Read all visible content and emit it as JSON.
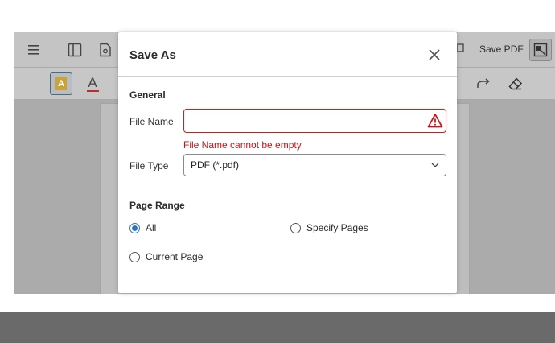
{
  "toolbar": {
    "save_pdf_label": "Save PDF"
  },
  "dialog": {
    "title": "Save As",
    "general": {
      "heading": "General",
      "file_name_label": "File Name",
      "file_name_value": "",
      "file_name_error": "File Name cannot be empty",
      "file_type_label": "File Type",
      "file_type_value": "PDF (*.pdf)"
    },
    "page_range": {
      "heading": "Page Range",
      "options": [
        {
          "label": "All",
          "selected": true
        },
        {
          "label": "Specify Pages",
          "selected": false
        },
        {
          "label": "Current Page",
          "selected": false
        }
      ]
    }
  },
  "colors": {
    "error": "#c8141a",
    "radio_selected": "#2f74c0",
    "highlight_accent": "#c9a23a",
    "text_color_underline": "#b6312b"
  },
  "icons": [
    "menu-icon",
    "sidebar-toggle-icon",
    "document-settings-icon",
    "copy-icon",
    "fit-page-icon",
    "highlight-icon",
    "text-color-icon",
    "redo-icon",
    "eraser-icon",
    "close-icon",
    "warning-icon",
    "chevron-down-icon"
  ]
}
